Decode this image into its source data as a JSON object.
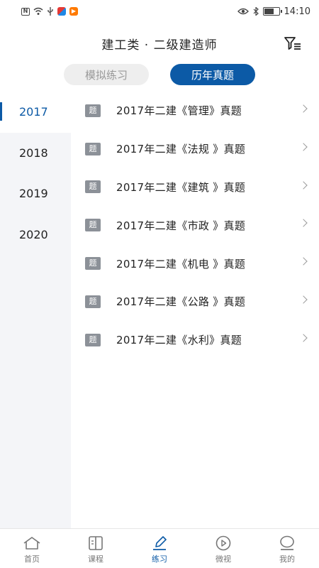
{
  "status_bar": {
    "time": "14:10",
    "box_icon_text": "N"
  },
  "header": {
    "title": "建工类 · 二级建造师"
  },
  "tabs": [
    {
      "label": "模拟练习",
      "active": false
    },
    {
      "label": "历年真题",
      "active": true
    }
  ],
  "years": [
    "2017",
    "2018",
    "2019",
    "2020"
  ],
  "selected_year": "2017",
  "papers": [
    {
      "badge": "题",
      "title": "2017年二建《管理》真题"
    },
    {
      "badge": "题",
      "title": "2017年二建《法规 》真题"
    },
    {
      "badge": "题",
      "title": "2017年二建《建筑 》真题"
    },
    {
      "badge": "题",
      "title": "2017年二建《市政 》真题"
    },
    {
      "badge": "题",
      "title": "2017年二建《机电 》真题"
    },
    {
      "badge": "题",
      "title": "2017年二建《公路 》真题"
    },
    {
      "badge": "题",
      "title": "2017年二建《水利》真题"
    }
  ],
  "bottom_nav": [
    {
      "label": "首页",
      "icon": "home-icon",
      "active": false
    },
    {
      "label": "课程",
      "icon": "book-icon",
      "active": false
    },
    {
      "label": "练习",
      "icon": "pencil-icon",
      "active": true
    },
    {
      "label": "微视",
      "icon": "play-icon",
      "active": false
    },
    {
      "label": "我的",
      "icon": "profile-icon",
      "active": false
    }
  ],
  "colors": {
    "accent": "#0c5aa6",
    "sidebar_bg": "#f4f5f8",
    "badge_bg": "#8c9198"
  }
}
